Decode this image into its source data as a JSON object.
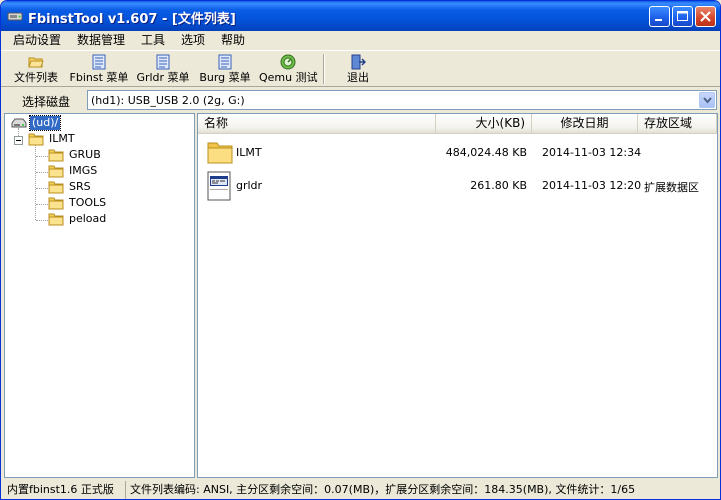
{
  "window": {
    "title": "FbinstTool v1.607 - [文件列表]"
  },
  "menu": [
    "启动设置",
    "数据管理",
    "工具",
    "选项",
    "帮助"
  ],
  "toolbar": {
    "file_list": "文件列表",
    "fbinst_menu": "Fbinst 菜单",
    "grldr_menu": "Grldr 菜单",
    "burg_menu": "Burg 菜单",
    "qemu_test": "Qemu 测试",
    "exit": "退出"
  },
  "disk": {
    "label": "选择磁盘",
    "selected": "(hd1): USB_USB 2.0 (2g, G:)"
  },
  "tree": {
    "root": "(ud)/",
    "ilmt": "ILMT",
    "children": [
      "GRUB",
      "IMGS",
      "SRS",
      "TOOLS",
      "peload"
    ]
  },
  "list": {
    "columns": {
      "name": "名称",
      "size": "大小(KB)",
      "date": "修改日期",
      "region": "存放区域"
    },
    "rows": [
      {
        "name": "ILMT",
        "size": "484,024.48 KB",
        "date": "2014-11-03 12:34",
        "region": "",
        "icon": "folder-icon"
      },
      {
        "name": "grldr",
        "size": "261.80 KB",
        "date": "2014-11-03 12:20",
        "region": "扩展数据区",
        "icon": "file-icon"
      }
    ]
  },
  "status": {
    "version": "内置fbinst1.6 正式版",
    "info": "文件列表编码: ANSI, 主分区剩余空间：0.07(MB)，扩展分区剩余空间：184.35(MB), 文件统计：1/65"
  },
  "colors": {
    "titlebar": "#0a5ce6",
    "selection": "#316ac5",
    "face": "#ece9d8"
  }
}
